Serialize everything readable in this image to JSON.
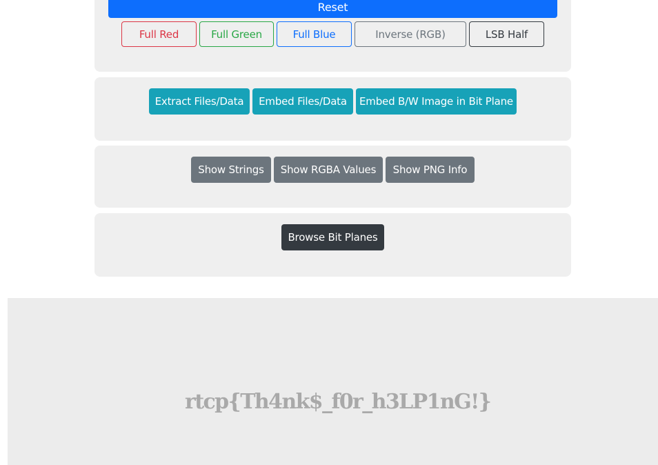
{
  "filters": {
    "reset_label": "Reset",
    "full_red_label": "Full Red",
    "full_green_label": "Full Green",
    "full_blue_label": "Full Blue",
    "inverse_rgb_label": "Inverse (RGB)",
    "lsb_half_label": "LSB Half"
  },
  "data_tools": {
    "extract_label": "Extract Files/Data",
    "embed_label": "Embed Files/Data",
    "embed_bw_label": "Embed B/W Image in Bit Plane"
  },
  "info_tools": {
    "show_strings_label": "Show Strings",
    "show_rgba_label": "Show RGBA Values",
    "show_png_info_label": "Show PNG Info"
  },
  "bitplane_tools": {
    "browse_label": "Browse Bit Planes"
  },
  "preview": {
    "image_text": "rtcp{Th4nk$_f0r_h3LP1nG!}"
  },
  "colors": {
    "primary": "#0d6efd",
    "info": "#17a2b8",
    "secondary": "#6c757d",
    "dark": "#343a40",
    "red": "#dc3545",
    "green": "#28a745"
  }
}
